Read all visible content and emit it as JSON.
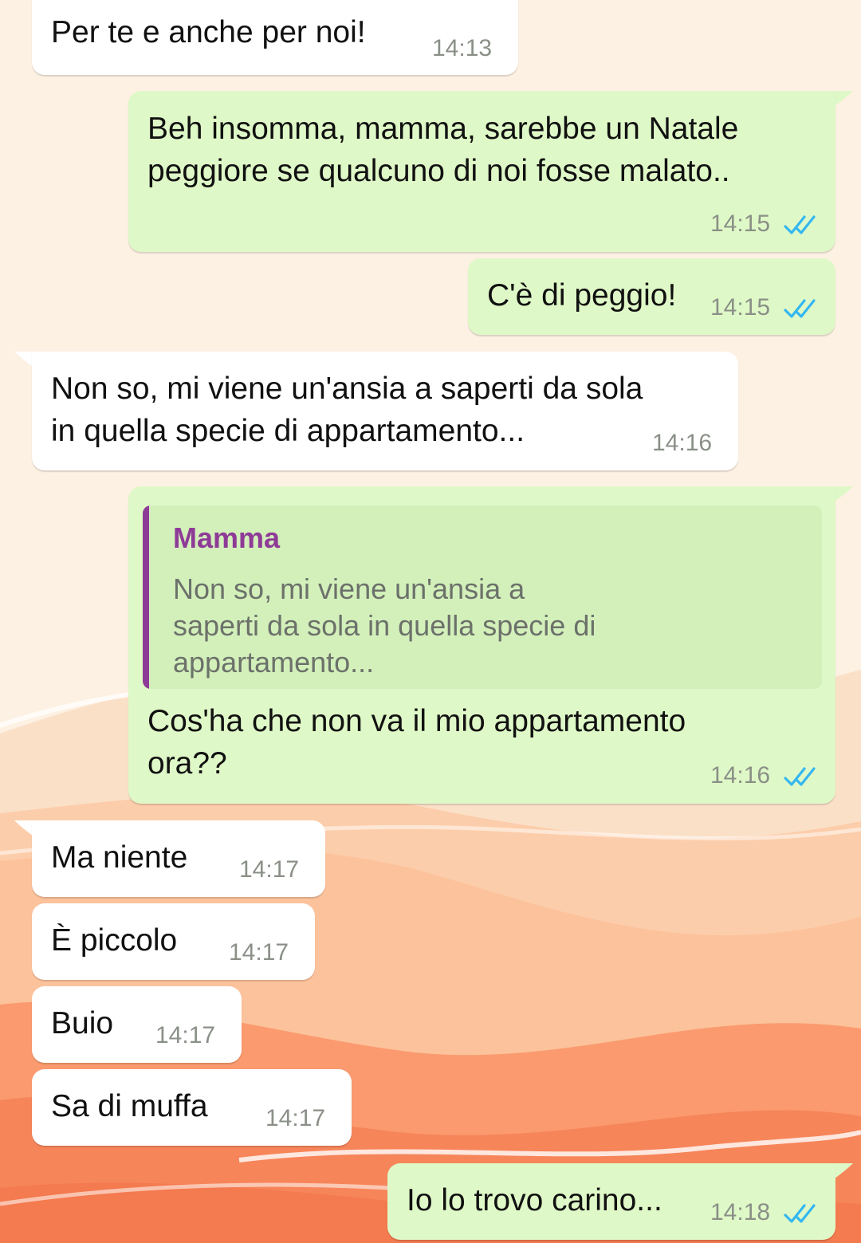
{
  "colors": {
    "incoming_bubble": "#ffffff",
    "outgoing_bubble": "#dff8c7",
    "quote_background": "#d3f0bb",
    "quote_accent": "#8e3b97",
    "read_tick": "#34b7f1",
    "timestamp": "#8a9087"
  },
  "messages": [
    {
      "direction": "incoming",
      "lines": [
        "Per te e anche per noi!"
      ],
      "time": "14:13"
    },
    {
      "direction": "outgoing",
      "lines": [
        "Beh insomma, mamma, sarebbe un Natale",
        "peggiore se qualcuno di noi fosse malato.."
      ],
      "time": "14:15",
      "status_icon": "double-check-read"
    },
    {
      "direction": "outgoing",
      "lines": [
        "C'è di peggio!"
      ],
      "time": "14:15",
      "status_icon": "double-check-read"
    },
    {
      "direction": "incoming",
      "lines": [
        "Non so, mi viene un'ansia a saperti da sola",
        "in quella specie di appartamento..."
      ],
      "time": "14:16"
    },
    {
      "direction": "outgoing",
      "quote": {
        "author": "Mamma",
        "lines": [
          "Non so, mi viene un'ansia a",
          "saperti da sola in quella specie di",
          "appartamento..."
        ]
      },
      "lines": [
        "Cos'ha che non va il mio appartamento",
        "ora??"
      ],
      "time": "14:16",
      "status_icon": "double-check-read"
    },
    {
      "direction": "incoming",
      "lines": [
        "Ma niente"
      ],
      "time": "14:17"
    },
    {
      "direction": "incoming",
      "lines": [
        "È piccolo"
      ],
      "time": "14:17"
    },
    {
      "direction": "incoming",
      "lines": [
        "Buio"
      ],
      "time": "14:17"
    },
    {
      "direction": "incoming",
      "lines": [
        "Sa di muffa"
      ],
      "time": "14:17"
    },
    {
      "direction": "outgoing",
      "lines": [
        "Io lo trovo carino..."
      ],
      "time": "14:18",
      "status_icon": "double-check-read"
    }
  ]
}
